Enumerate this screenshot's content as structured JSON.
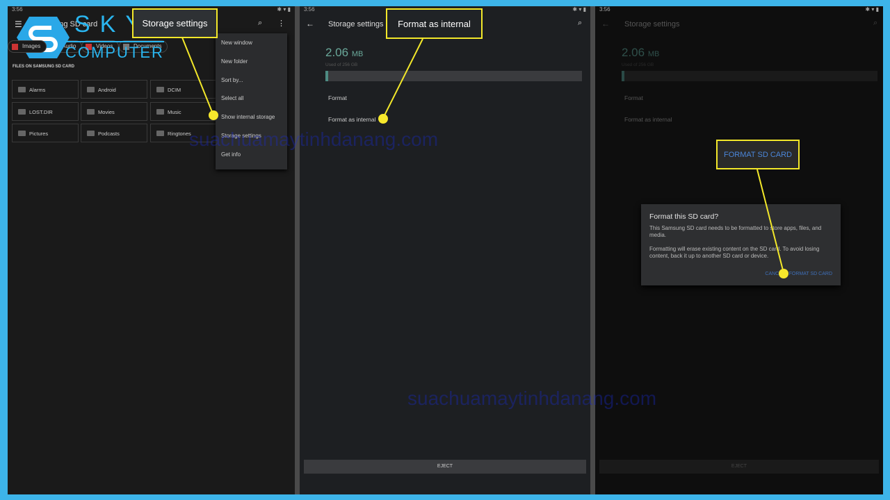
{
  "status": {
    "time": "3:56"
  },
  "panel1": {
    "title": "Samsung SD card",
    "chips": [
      "Images",
      "Audio",
      "Videos",
      "Documents"
    ],
    "section": "FILES ON SAMSUNG SD CARD",
    "folders": [
      "Alarms",
      "Android",
      "DCIM",
      "LOST.DIR",
      "Movies",
      "Music",
      "Pictures",
      "Podcasts",
      "Ringtones"
    ],
    "menu": [
      "New window",
      "New folder",
      "Sort by...",
      "Select all",
      "Show internal storage",
      "Storage settings",
      "Get info"
    ],
    "callout": "Storage settings"
  },
  "panel2": {
    "title": "Storage settings",
    "used_value": "2.06",
    "used_unit": "MB",
    "used_of": "Used of 256 GB",
    "usage_fraction": 1e-05,
    "items": [
      "Format",
      "Format as internal"
    ],
    "eject": "EJECT",
    "callout": "Format as internal"
  },
  "panel3": {
    "title": "Storage settings",
    "used_value": "2.06",
    "used_unit": "MB",
    "used_of": "Used of 256 GB",
    "items": [
      "Format",
      "Format as internal"
    ],
    "eject": "EJECT",
    "callout": "FORMAT SD CARD",
    "dialog": {
      "title": "Format this SD card?",
      "p1": "This Samsung SD card needs to be formatted to store apps, files, and media.",
      "p2": "Formatting will erase existing content on the SD card. To avoid losing content, back it up to another SD card or device.",
      "cancel": "CANCEL",
      "confirm": "FORMAT SD CARD"
    }
  },
  "logo": {
    "text1": "SKY",
    "text2": "COMPUTER"
  },
  "watermark": "suachuamaytinhdanang.com",
  "colors": {
    "frame": "#3db4e9",
    "highlight": "#f3e82a",
    "accent": "#6aa89a",
    "dialog_button": "#3f6fb8"
  }
}
